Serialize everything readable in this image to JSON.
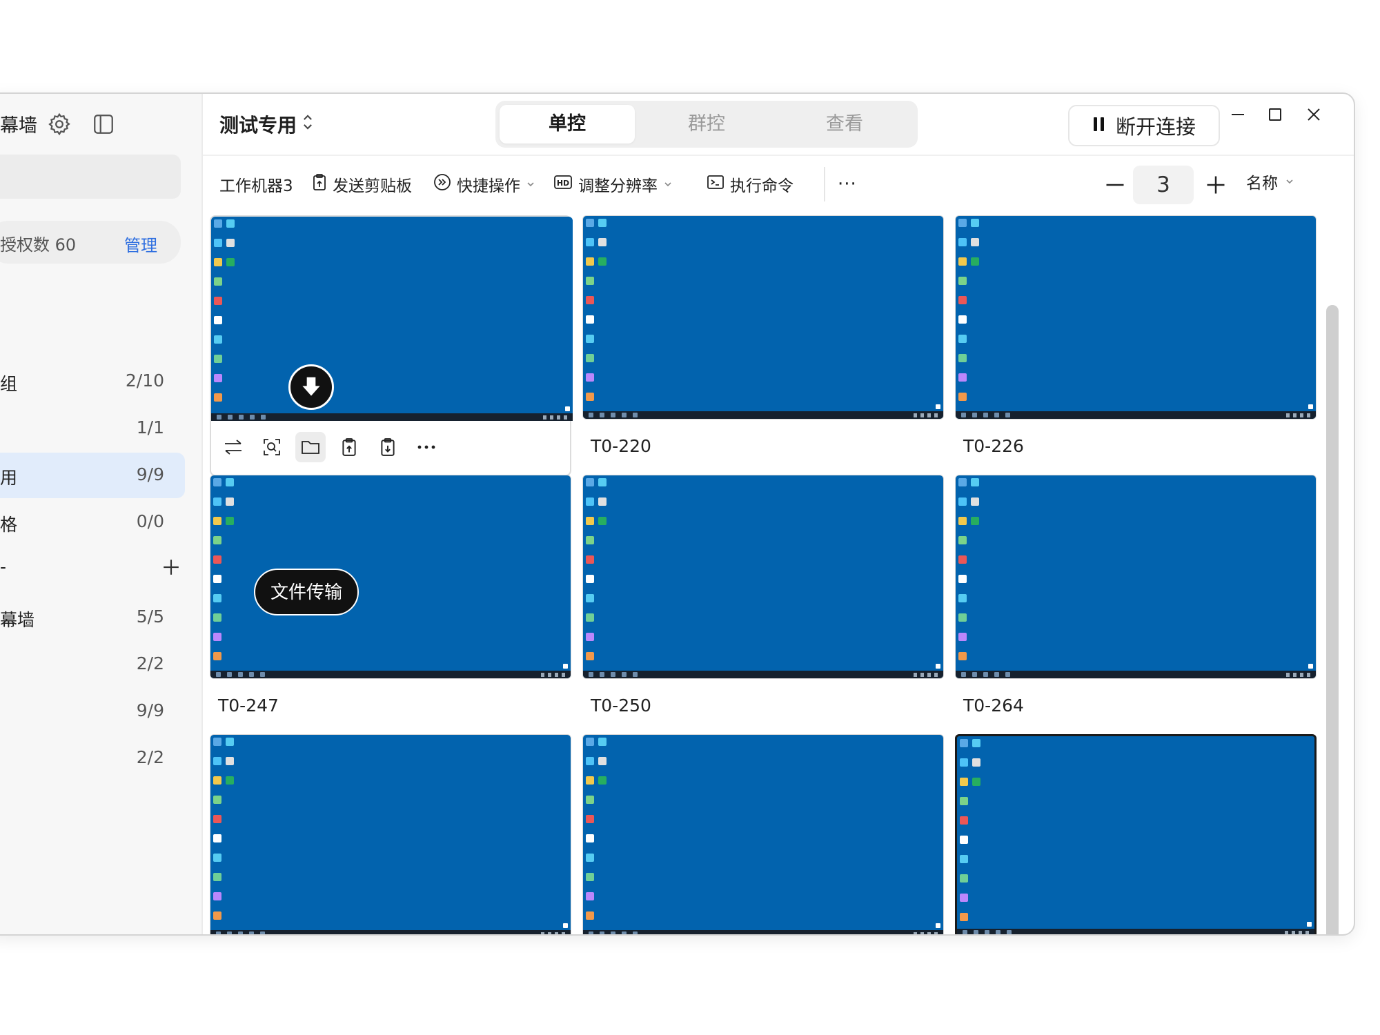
{
  "sidebar": {
    "title": "幕墙",
    "license": {
      "text": "授权数 60",
      "manage": "管理"
    },
    "groups": [
      {
        "label": "组",
        "count": "2/10"
      },
      {
        "label": "",
        "count": "1/1"
      },
      {
        "label": "用",
        "count": "9/9"
      },
      {
        "label": "格",
        "count": "0/0"
      }
    ],
    "section_label": "-",
    "walls": [
      {
        "label": "幕墙",
        "count": "5/5"
      },
      {
        "label": "",
        "count": "2/2"
      },
      {
        "label": "",
        "count": "9/9"
      },
      {
        "label": "",
        "count": "2/2"
      }
    ]
  },
  "header": {
    "group_title": "测试专用",
    "tabs": [
      "单控",
      "群控",
      "查看"
    ],
    "active_tab": 0,
    "disconnect": "断开连接"
  },
  "toolbar": {
    "machine": "工作机器3",
    "clipboard": "发送剪贴板",
    "quick": "快捷操作",
    "resolution": "调整分辨率",
    "command": "执行命令",
    "more": "···",
    "zoom": "3",
    "sort": "名称"
  },
  "grid": {
    "cells": [
      {
        "name": "",
        "state": "hovered"
      },
      {
        "name": "T0-220",
        "state": "normal"
      },
      {
        "name": "T0-226",
        "state": "normal"
      },
      {
        "name": "T0-247",
        "state": "normal"
      },
      {
        "name": "T0-250",
        "state": "normal"
      },
      {
        "name": "T0-264",
        "state": "normal"
      },
      {
        "name": "",
        "state": "normal"
      },
      {
        "name": "",
        "state": "normal"
      },
      {
        "name": "",
        "state": "selected"
      }
    ],
    "tooltip": "文件传输"
  },
  "colors": {
    "desktop": "#0263ae",
    "accent": "#2f6fe0",
    "active_row": "#e1ecfb"
  }
}
